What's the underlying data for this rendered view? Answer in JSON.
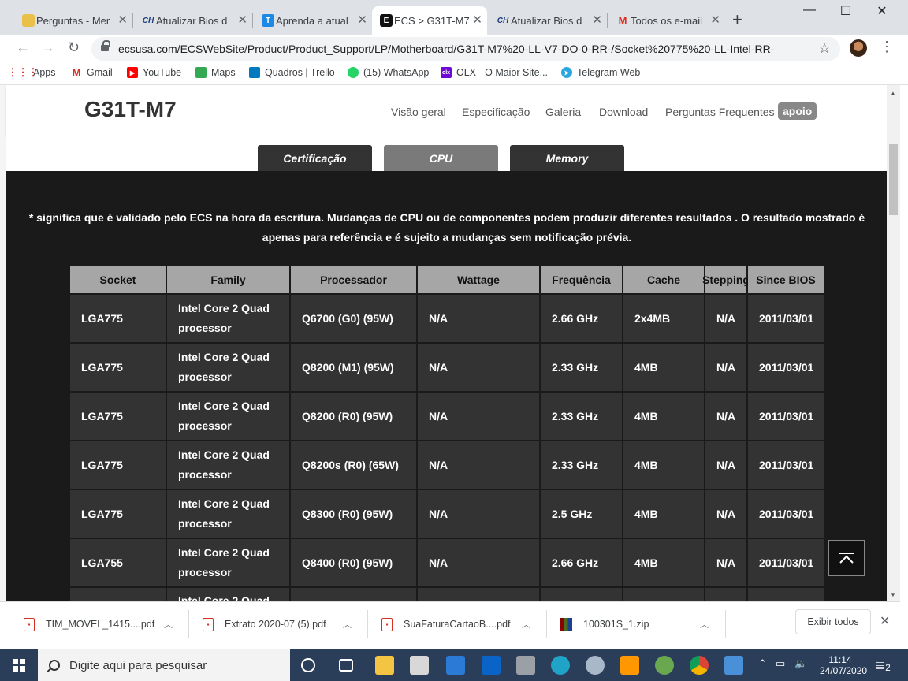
{
  "browser": {
    "tabs": [
      {
        "label": "Perguntas - Mer",
        "icon": "forum-icon",
        "active": false
      },
      {
        "label": "Atualizar Bios d",
        "icon": "ch-logo-icon",
        "active": false
      },
      {
        "label": "Aprenda a atual",
        "icon": "t-logo-icon",
        "active": false
      },
      {
        "label": "ECS > G31T-M7",
        "icon": "ecs-logo-icon",
        "active": true
      },
      {
        "label": "Atualizar Bios d",
        "icon": "ch-logo-icon",
        "active": false
      },
      {
        "label": "Todos os e-mail",
        "icon": "gmail-icon",
        "active": false
      }
    ],
    "url": "ecsusa.com/ECSWebSite/Product/Product_Support/LP/Motherboard/G31T-M7%20-LL-V7-DO-0-RR-/Socket%20775%20-LL-Intel-RR-",
    "bookmarks": [
      {
        "label": "Apps",
        "icon": "apps-grid-icon"
      },
      {
        "label": "Gmail",
        "icon": "gmail-icon"
      },
      {
        "label": "YouTube",
        "icon": "youtube-icon"
      },
      {
        "label": "Maps",
        "icon": "maps-icon"
      },
      {
        "label": "Quadros | Trello",
        "icon": "trello-icon"
      },
      {
        "label": "(15) WhatsApp",
        "icon": "whatsapp-icon"
      },
      {
        "label": "OLX - O Maior Site...",
        "icon": "olx-icon"
      },
      {
        "label": "Telegram Web",
        "icon": "telegram-icon"
      }
    ]
  },
  "page": {
    "product_title": "G31T-M7",
    "nav": [
      "Visão geral",
      "Especificação",
      "Galeria",
      "Download",
      "Perguntas Frequentes",
      "apoio"
    ],
    "subtabs": [
      "Certificação",
      "CPU",
      "Memory"
    ],
    "active_subtab": "CPU",
    "disclaimer": "* significa que é validado pelo ECS na hora da escritura. Mudanças de CPU ou de componentes podem produzir  diferentes resultados . O resultado mostrado é apenas para referência e é sujeito a mudanças sem notificação prévia.",
    "table": {
      "headers": [
        "Socket",
        "Family",
        "Processador",
        "Wattage",
        "Frequência",
        "Cache",
        "Stepping",
        "Since BIOS"
      ],
      "rows": [
        [
          "LGA775",
          "Intel Core 2 Quad processor",
          "Q6700 (G0) (95W)",
          "N/A",
          "2.66 GHz",
          "2x4MB",
          "N/A",
          "2011/03/01"
        ],
        [
          "LGA775",
          "Intel Core 2 Quad processor",
          "Q8200 (M1) (95W)",
          "N/A",
          "2.33 GHz",
          "4MB",
          "N/A",
          "2011/03/01"
        ],
        [
          "LGA775",
          "Intel Core 2 Quad processor",
          "Q8200 (R0) (95W)",
          "N/A",
          "2.33 GHz",
          "4MB",
          "N/A",
          "2011/03/01"
        ],
        [
          "LGA775",
          "Intel Core 2 Quad processor",
          "Q8200s (R0) (65W)",
          "N/A",
          "2.33 GHz",
          "4MB",
          "N/A",
          "2011/03/01"
        ],
        [
          "LGA775",
          "Intel Core 2 Quad processor",
          "Q8300 (R0) (95W)",
          "N/A",
          "2.5 GHz",
          "4MB",
          "N/A",
          "2011/03/01"
        ],
        [
          "LGA755",
          "Intel Core 2 Quad processor",
          "Q8400 (R0) (95W)",
          "N/A",
          "2.66 GHz",
          "4MB",
          "N/A",
          "2011/03/01"
        ],
        [
          "",
          "Intel Core 2 Quad",
          "",
          "",
          "",
          "",
          "",
          ""
        ]
      ]
    }
  },
  "downloads": {
    "items": [
      {
        "name": "TIM_MOVEL_1415....pdf",
        "type": "pdf"
      },
      {
        "name": "Extrato 2020-07 (5).pdf",
        "type": "pdf"
      },
      {
        "name": "SuaFaturaCartaoB....pdf",
        "type": "pdf"
      },
      {
        "name": "100301S_1.zip",
        "type": "zip"
      }
    ],
    "show_all": "Exibir todos"
  },
  "taskbar": {
    "search_placeholder": "Digite aqui para pesquisar",
    "time": "11:14",
    "date": "24/07/2020",
    "notifications": "2"
  }
}
